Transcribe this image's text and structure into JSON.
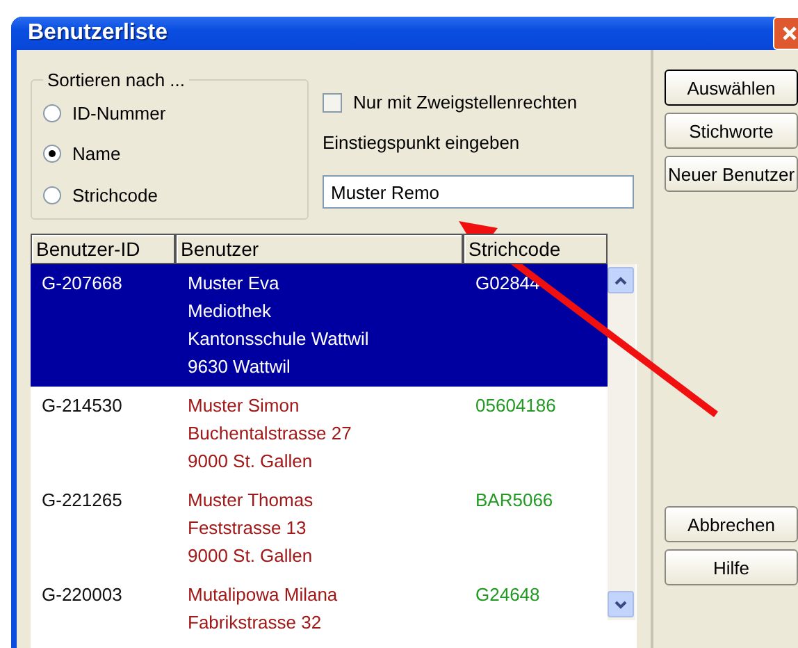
{
  "window": {
    "title": "Benutzerliste"
  },
  "sort_group": {
    "title": "Sortieren nach ...",
    "options": [
      {
        "label": "ID-Nummer",
        "selected": false
      },
      {
        "label": "Name",
        "selected": true
      },
      {
        "label": "Strichcode",
        "selected": false
      }
    ]
  },
  "branch_checkbox": {
    "label": "Nur mit Zweigstellenrechten",
    "checked": false
  },
  "entry_point": {
    "label": "Einstiegspunkt eingeben",
    "value": "Muster Remo"
  },
  "table": {
    "columns": [
      "Benutzer-ID",
      "Benutzer",
      "Strichcode"
    ],
    "rows": [
      {
        "id": "G-207668",
        "user": [
          "Muster Eva",
          "Mediothek",
          "Kantonsschule Wattwil",
          "9630 Wattwil"
        ],
        "barcode": "G02844",
        "selected": true
      },
      {
        "id": "G-214530",
        "user": [
          "Muster Simon",
          "Buchentalstrasse 27",
          "9000 St. Gallen"
        ],
        "barcode": "05604186",
        "selected": false
      },
      {
        "id": "G-221265",
        "user": [
          "Muster Thomas",
          "Feststrasse 13",
          "9000 St. Gallen"
        ],
        "barcode": "BAR5066",
        "selected": false
      },
      {
        "id": "G-220003",
        "user": [
          "Mutalipowa Milana",
          "Fabrikstrasse 32"
        ],
        "barcode": "G24648",
        "selected": false
      }
    ]
  },
  "buttons_top": [
    {
      "label": "Auswählen",
      "default": true
    },
    {
      "label": "Stichworte",
      "default": false
    },
    {
      "label": "Neuer Benutzer",
      "default": false
    }
  ],
  "buttons_bottom": [
    {
      "label": "Abbrechen",
      "default": false
    },
    {
      "label": "Hilfe",
      "default": false
    }
  ]
}
